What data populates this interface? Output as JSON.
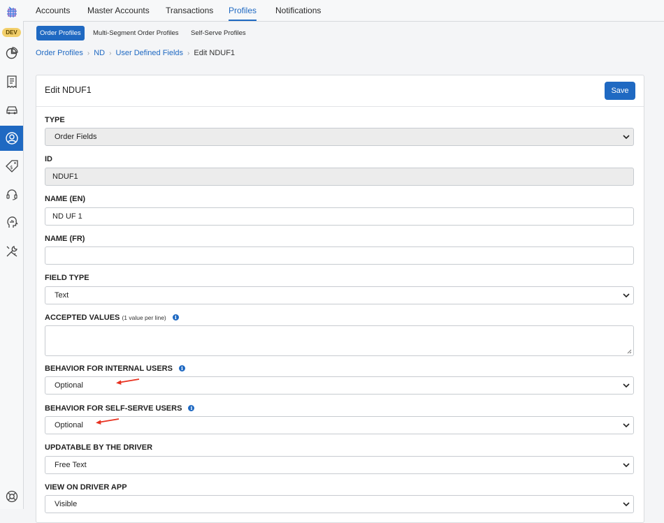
{
  "env_badge": "DEV",
  "rail": {
    "logo": "dispatch-logo-icon",
    "icons": [
      "pie-chart-icon",
      "receipt-icon",
      "car-icon",
      "user-circle-icon",
      "price-tag-icon",
      "headset-icon",
      "analytics-head-icon",
      "tools-icon",
      "lifebuoy-icon"
    ]
  },
  "top_tabs": [
    {
      "label": "Accounts"
    },
    {
      "label": "Master Accounts"
    },
    {
      "label": "Transactions"
    },
    {
      "label": "Profiles",
      "active": true
    },
    {
      "label": "Notifications"
    }
  ],
  "sub_tabs": [
    {
      "label": "Order Profiles",
      "active": true
    },
    {
      "label": "Multi-Segment Order Profiles"
    },
    {
      "label": "Self-Serve Profiles"
    }
  ],
  "breadcrumb": {
    "items": [
      "Order Profiles",
      "ND",
      "User Defined Fields"
    ],
    "current": "Edit NDUF1"
  },
  "card": {
    "title": "Edit NDUF1",
    "save_label": "Save"
  },
  "form": {
    "type": {
      "label": "TYPE",
      "value": "Order Fields"
    },
    "id": {
      "label": "ID",
      "value": "NDUF1"
    },
    "name_en": {
      "label": "NAME (EN)",
      "value": "ND UF 1"
    },
    "name_fr": {
      "label": "NAME (FR)",
      "value": ""
    },
    "field_type": {
      "label": "FIELD TYPE",
      "value": "Text"
    },
    "accepted_values": {
      "label": "ACCEPTED VALUES",
      "hint": "(1 value per line)",
      "value": ""
    },
    "internal_behavior": {
      "label": "BEHAVIOR FOR INTERNAL USERS",
      "value": "Optional"
    },
    "selfserve_behavior": {
      "label": "BEHAVIOR FOR SELF-SERVE USERS",
      "value": "Optional"
    },
    "updatable": {
      "label": "UPDATABLE BY THE DRIVER",
      "value": "Free Text"
    },
    "view_driver": {
      "label": "VIEW ON DRIVER APP",
      "value": "Visible"
    }
  },
  "colors": {
    "accent": "#1f69c2",
    "annotation_arrow": "#e8311f",
    "dev_badge": "#f2cf6b"
  }
}
